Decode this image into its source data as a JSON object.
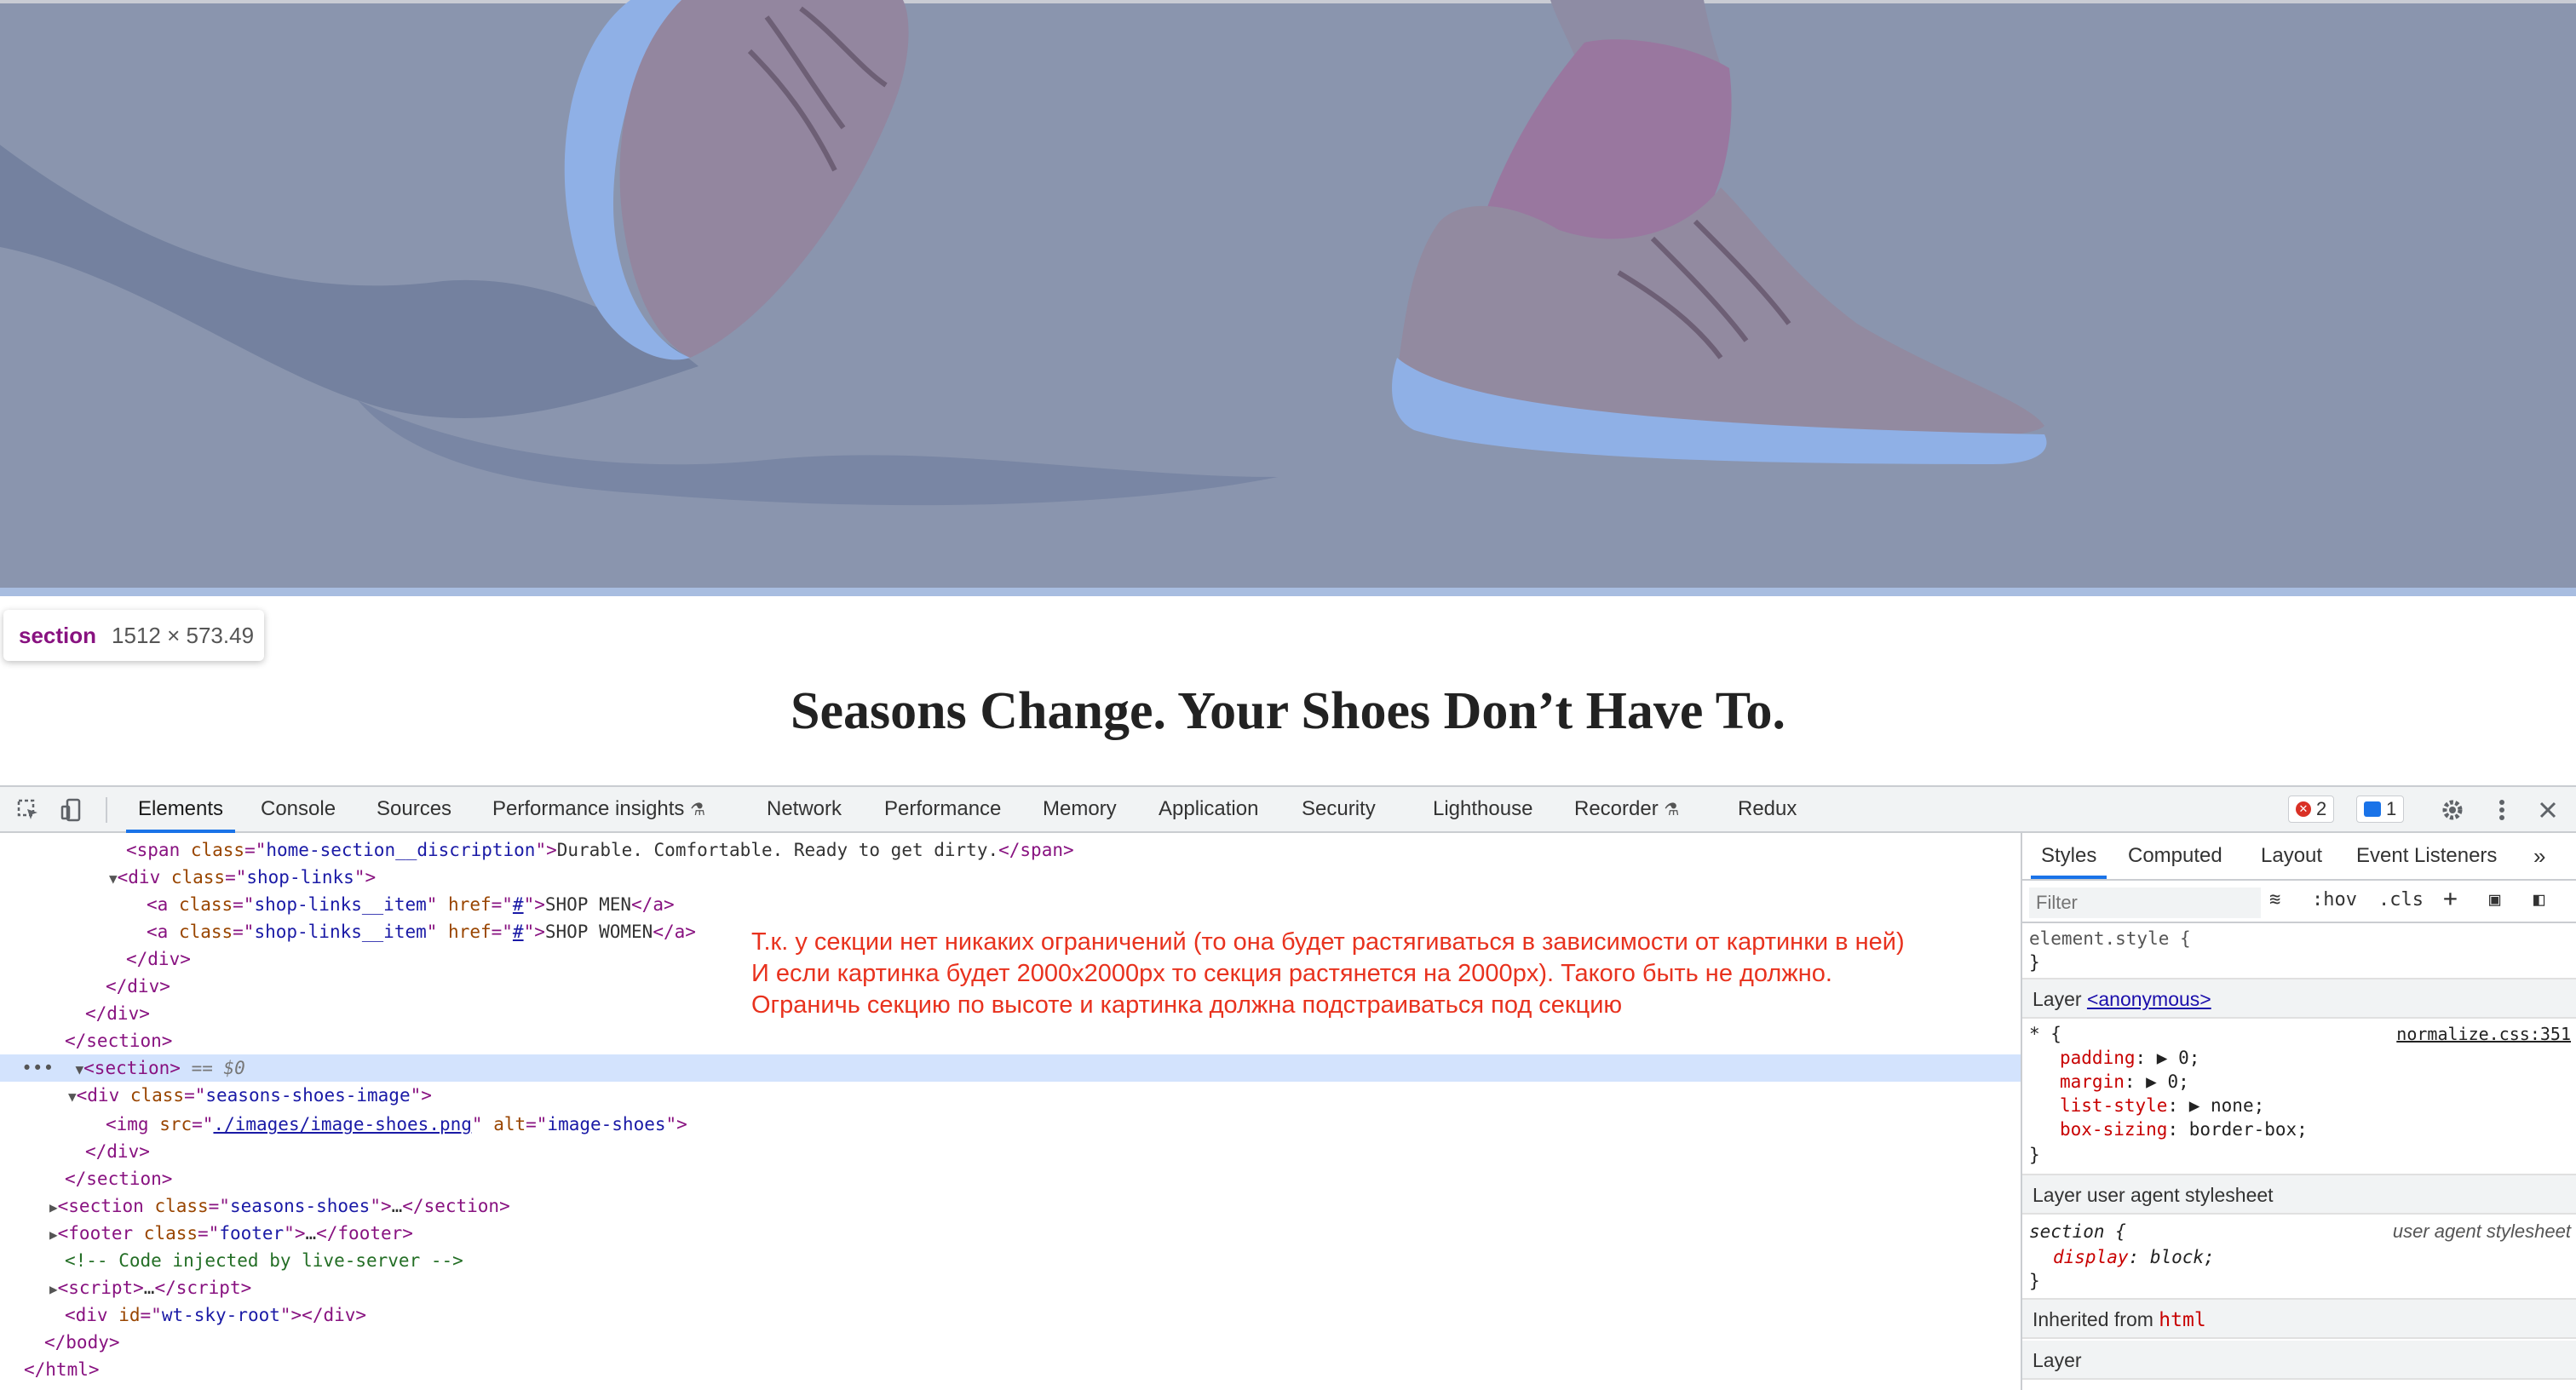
{
  "page": {
    "heading": "Seasons Change. Your Shoes Don’t Have To.",
    "tooltip": {
      "tag": "section",
      "dims": "1512 × 573.49"
    }
  },
  "devtools": {
    "tabs": [
      {
        "label": "Elements",
        "active": true
      },
      {
        "label": "Console"
      },
      {
        "label": "Sources"
      },
      {
        "label": "Performance insights",
        "experimental": true
      },
      {
        "label": "Network"
      },
      {
        "label": "Performance"
      },
      {
        "label": "Memory"
      },
      {
        "label": "Application"
      },
      {
        "label": "Security"
      },
      {
        "label": "Lighthouse"
      },
      {
        "label": "Recorder",
        "experimental": true
      },
      {
        "label": "Redux"
      }
    ],
    "errors_count": "2",
    "messages_count": "1",
    "annotation": [
      "Т.к. у секции нет никаких ограничений (то она будет растягиваться в зависимости от картинки в ней)",
      "И если картинка будет 2000x2000px то секция растянется на 2000px). Такого быть не должно.",
      "Ограничь секцию по высоте и картинка должна подстраиваться под секцию"
    ],
    "dom": {
      "span_class": "home-section__discription",
      "span_text": "Durable. Comfortable. Ready to get dirty.",
      "shop_links_class": "shop-links",
      "link_class": "shop-links__item",
      "link_href": "#",
      "link1_text": "SHOP MEN",
      "link2_text": "SHOP WOMEN",
      "selected_marker": "== $0",
      "image_div_class": "seasons-shoes-image",
      "img_src": "./images/image-shoes.png",
      "img_alt": "image-shoes",
      "section2_class": "seasons-shoes",
      "footer_class": "footer",
      "comment": "<!-- Code injected by live-server -->",
      "root_div_id": "wt-sky-root"
    },
    "styles": {
      "tabs": [
        "Styles",
        "Computed",
        "Layout",
        "Event Listeners"
      ],
      "filter_placeholder": "Filter",
      "hov": ":hov",
      "cls": ".cls",
      "element_style": "element.style {",
      "layer1_label": "Layer",
      "layer1_link": "<anonymous>",
      "star_selector": "* {",
      "star_source": "normalize.css:351",
      "decls": [
        {
          "prop": "padding",
          "value": "0;"
        },
        {
          "prop": "margin",
          "value": "0;"
        },
        {
          "prop": "list-style",
          "value": "none;"
        },
        {
          "prop": "box-sizing",
          "value": "border-box;"
        }
      ],
      "layer2_label": "Layer user agent stylesheet",
      "section_selector": "section {",
      "ua_source": "user agent stylesheet",
      "section_decl_prop": "display",
      "section_decl_value": "block;",
      "inherited_label": "Inherited from",
      "inherited_tag": "html",
      "layer3_label": "Layer"
    }
  }
}
